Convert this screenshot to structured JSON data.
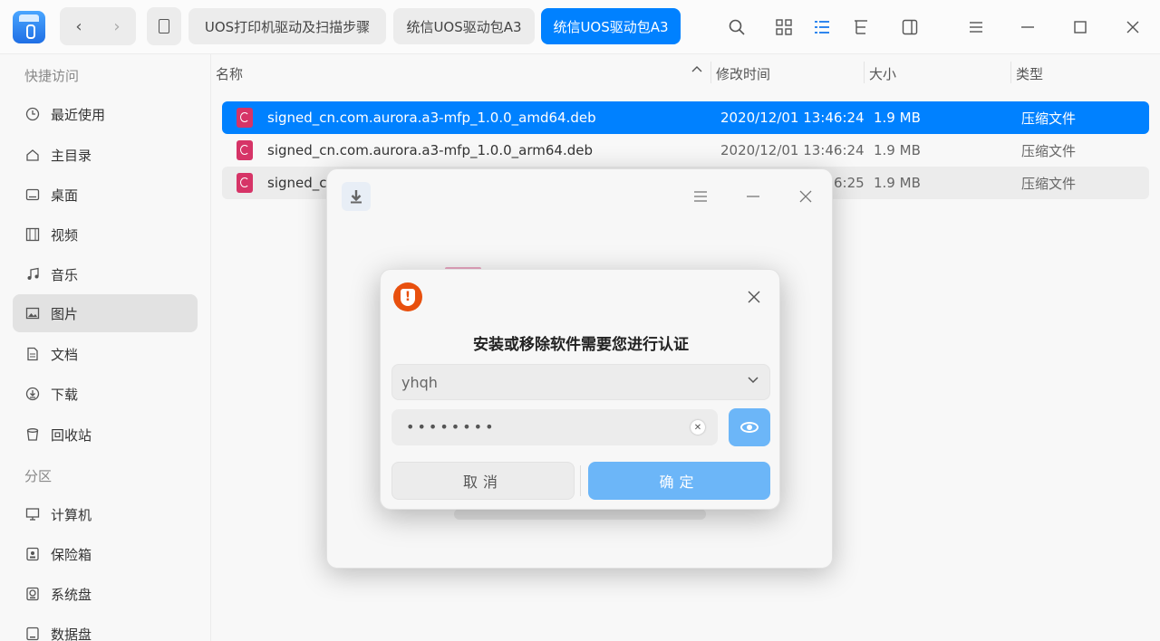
{
  "titlebar": {
    "breadcrumbs": [
      "UOS打印机驱动及扫描步骤",
      "统信UOS驱动包A3",
      "统信UOS驱动包A3"
    ],
    "back_icon": "‹",
    "forward_icon": "›"
  },
  "sidebar": {
    "quick_access_label": "快捷访问",
    "partitions_label": "分区",
    "items": [
      {
        "label": "最近使用",
        "icon": "clock-icon"
      },
      {
        "label": "主目录",
        "icon": "home-icon"
      },
      {
        "label": "桌面",
        "icon": "desktop-icon"
      },
      {
        "label": "视频",
        "icon": "video-icon"
      },
      {
        "label": "音乐",
        "icon": "music-icon"
      },
      {
        "label": "图片",
        "icon": "picture-icon"
      },
      {
        "label": "文档",
        "icon": "document-icon"
      },
      {
        "label": "下载",
        "icon": "download-icon"
      },
      {
        "label": "回收站",
        "icon": "trash-icon"
      }
    ],
    "partitions": [
      {
        "label": "计算机",
        "icon": "computer-icon"
      },
      {
        "label": "保险箱",
        "icon": "vault-icon"
      },
      {
        "label": "系统盘",
        "icon": "system-disk-icon"
      },
      {
        "label": "数据盘",
        "icon": "data-disk-icon"
      }
    ]
  },
  "file_list": {
    "columns": {
      "name": "名称",
      "modified": "修改时间",
      "size": "大小",
      "type": "类型"
    },
    "rows": [
      {
        "name": "signed_cn.com.aurora.a3-mfp_1.0.0_amd64.deb",
        "modified": "2020/12/01 13:46:24",
        "size": "1.9 MB",
        "type": "压缩文件"
      },
      {
        "name": "signed_cn.com.aurora.a3-mfp_1.0.0_arm64.deb",
        "modified": "2020/12/01 13:46:24",
        "size": "1.9 MB",
        "type": "压缩文件"
      },
      {
        "name": "signed_c",
        "modified": "6:25",
        "size": "1.9 MB",
        "type": "压缩文件"
      }
    ]
  },
  "auth_dialog": {
    "title": "安装或移除软件需要您进行认证",
    "username": "yhqh",
    "password_mask": "••••••••",
    "cancel_label": "取消",
    "confirm_label": "确定"
  },
  "colors": {
    "accent": "#0081ff",
    "confirm_button": "#6cb6f8",
    "shield": "#e8500e",
    "deb_icon": "#d63467"
  }
}
